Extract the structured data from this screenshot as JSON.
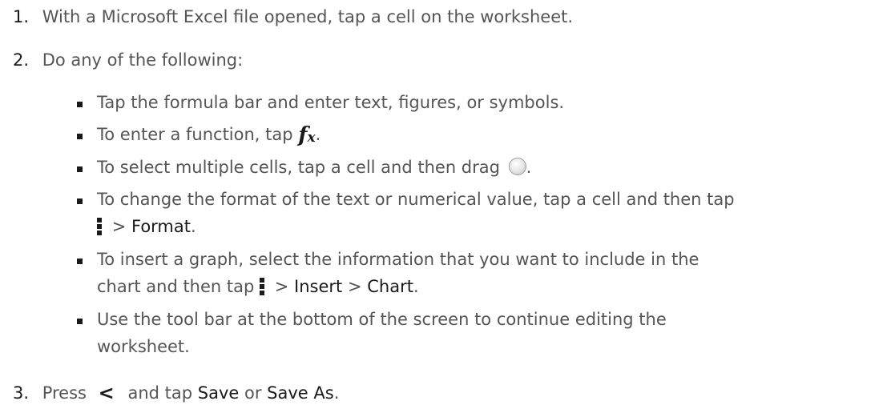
{
  "steps": [
    {
      "number": "1.",
      "text": "With a Microsoft Excel file opened, tap a cell on the worksheet."
    },
    {
      "number": "2.",
      "text": "Do any of the following:"
    },
    {
      "number": "3.",
      "text_before": "Press",
      "text_mid": "and tap",
      "kw_save": "Save",
      "text_or": "or",
      "kw_save_as": "Save As",
      "text_end": "."
    }
  ],
  "bullets": {
    "b1": "Tap the formula bar and enter text, figures, or symbols.",
    "b2_before": "To enter a function, tap",
    "b2_after": ".",
    "b3_before": "To select multiple cells, tap a cell and then drag",
    "b3_after": ".",
    "b4_line1": "To change the format of the text or numerical value, tap a cell and then tap",
    "b4_sep": ">",
    "b4_kw": "Format",
    "b4_end": ".",
    "b5_line1": "To insert a graph, select the information that you want to include in the",
    "b5_line2_before": "chart and then tap",
    "b5_sep1": ">",
    "b5_kw1": "Insert",
    "b5_sep2": ">",
    "b5_kw2": "Chart",
    "b5_end": ".",
    "b6_line1": "Use the tool bar at the bottom of the screen to continue editing the",
    "b6_line2": "worksheet."
  },
  "icons": {
    "function": "fx-icon",
    "selection_handle": "selection-handle-icon",
    "menu": "menu-icon",
    "back": "back-icon"
  },
  "icon_glyphs": {
    "fx_f": "f",
    "fx_x": "x",
    "back": "<"
  },
  "colors": {
    "body_text": "#555555",
    "keyword_text": "#1a1a1a",
    "background": "#ffffff"
  }
}
